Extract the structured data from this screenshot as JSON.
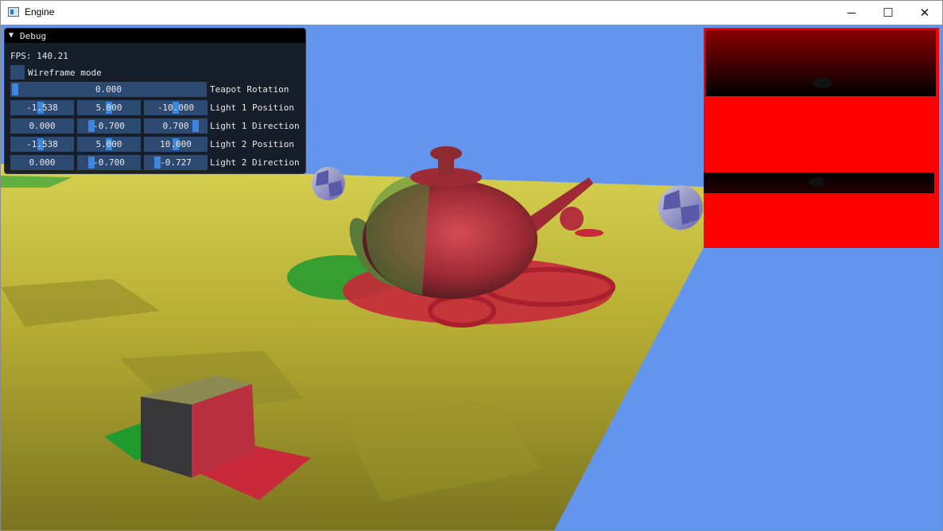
{
  "window": {
    "title": "Engine",
    "controls": {
      "minimize": "─",
      "maximize": "☐",
      "close": "✕"
    }
  },
  "debug": {
    "title": "Debug",
    "fps_label": "FPS: 140.21",
    "wireframe_label": "Wireframe mode",
    "wireframe_checked": false,
    "rows": [
      {
        "label": "Teapot Rotation",
        "values": [
          "0.000"
        ]
      },
      {
        "label": "Light 1 Position",
        "values": [
          "-1.538",
          "5.000",
          "-10.000"
        ]
      },
      {
        "label": "Light 1 Direction",
        "values": [
          "0.000",
          "-0.700",
          "0.700"
        ]
      },
      {
        "label": "Light 2 Position",
        "values": [
          "-1.538",
          "5.000",
          "10.000"
        ]
      },
      {
        "label": "Light 2 Direction",
        "values": [
          "0.000",
          "-0.700",
          "-0.727"
        ]
      }
    ]
  },
  "colors": {
    "sky": "#6495ed",
    "floor": "#b5ad35",
    "teapot": "#b3303d",
    "shadow_red": "#c7283a",
    "shadow_green": "#1f9a2f",
    "panel_bg": "#11161e",
    "field_bg": "#2d4a73",
    "grab": "#3d86e0",
    "preview_red": "#ff0000"
  },
  "icons": [
    "app-icon",
    "collapse-arrow-icon",
    "minimize-icon",
    "maximize-icon",
    "close-icon"
  ]
}
